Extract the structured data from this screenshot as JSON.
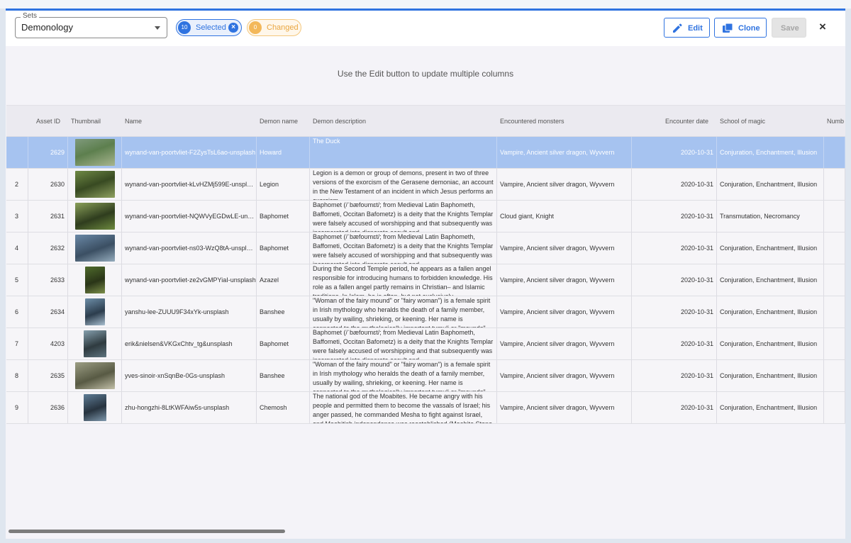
{
  "toolbar": {
    "sets_legend": "Sets",
    "sets_value": "Demonology",
    "selected_count": "10",
    "selected_label": "Selected",
    "changed_count": "0",
    "changed_label": "Changed",
    "edit_label": "Edit",
    "clone_label": "Clone",
    "save_label": "Save",
    "close_symbol": "×"
  },
  "hint": "Use the Edit button to update multiple columns",
  "columns": [
    "Asset ID",
    "Thumbnail",
    "Name",
    "Demon name",
    "Demon description",
    "Encountered monsters",
    "Encounter date",
    "School of magic",
    "Numb"
  ],
  "rows": [
    {
      "idx": "",
      "asset_id": "2629",
      "name": "wynand-van-poortvliet-F2ZysTsL6ao-unsplash",
      "demon": "Howard",
      "desc": "The Duck",
      "monsters": "Vampire, Ancient silver dragon, Wyvvern",
      "date": "2020-10-31",
      "school": "Conjuration, Enchantment, Illusion"
    },
    {
      "idx": "2",
      "asset_id": "2630",
      "name": "wynand-van-poortvliet-kLvHZMj599E-unsplas..",
      "demon": "Legion",
      "desc": "Legion is a demon or group of demons, present in two of three versions of the exorcism of the Gerasene demoniac, an account in the New Testament of an incident in which Jesus performs an exorcism.",
      "monsters": "Vampire, Ancient silver dragon, Wyvvern",
      "date": "2020-10-31",
      "school": "Conjuration, Enchantment, Illusion"
    },
    {
      "idx": "3",
      "asset_id": "2631",
      "name": "wynand-van-poortvliet-NQWVyEGDwLE-unspl..",
      "demon": "Baphomet",
      "desc": "Baphomet (/ˈbæfoʊmɛt/; from Medieval Latin Baphometh, Baffometi, Occitan Bafometz) is a deity that the Knights Templar were falsely accused of worshipping and that subsequently was incorporated into disparate occult and",
      "monsters": "Cloud giant, Knight",
      "date": "2020-10-31",
      "school": "Transmutation, Necromancy"
    },
    {
      "idx": "4",
      "asset_id": "2632",
      "name": "wynand-van-poortvliet-ns03-WzQ8tA-unsplas..",
      "demon": "Baphomet",
      "desc": "Baphomet (/ˈbæfoʊmɛt/; from Medieval Latin Baphometh, Baffometi, Occitan Bafometz) is a deity that the Knights Templar were falsely accused of worshipping and that subsequently was incorporated into disparate occult and",
      "monsters": "Vampire, Ancient silver dragon, Wyvvern",
      "date": "2020-10-31",
      "school": "Conjuration, Enchantment, Illusion"
    },
    {
      "idx": "5",
      "asset_id": "2633",
      "name": "wynand-van-poortvliet-ze2vGMPYiaI-unsplash",
      "demon": "Azazel",
      "desc": "During the Second Temple period, he appears as a fallen angel responsible for introducing humans to forbidden knowledge. His role as a fallen angel partly remains in Christian– and Islamic traditions. In Islam, he is often, but not exclusively",
      "monsters": "Vampire, Ancient silver dragon, Wyvvern",
      "date": "2020-10-31",
      "school": "Conjuration, Enchantment, Illusion"
    },
    {
      "idx": "6",
      "asset_id": "2634",
      "name": "yanshu-lee-ZUUU9F34xYk-unsplash",
      "demon": "Banshee",
      "desc": "\"Woman of the fairy mound\" or \"fairy woman\") is a female spirit in Irish mythology who heralds the death of a family member, usually by wailing, shrieking, or keening. Her name is connected to the mythologically important tumuli or \"mounds\"",
      "monsters": "Vampire, Ancient silver dragon, Wyvvern",
      "date": "2020-10-31",
      "school": "Conjuration, Enchantment, Illusion"
    },
    {
      "idx": "7",
      "asset_id": "4203",
      "name": "erik&nielsen&VKGxChtv_tg&unsplash",
      "demon": "Baphomet",
      "desc": "Baphomet (/ˈbæfoʊmɛt/; from Medieval Latin Baphometh, Baffometi, Occitan Bafometz) is a deity that the Knights Templar were falsely accused of worshipping and that subsequently was incorporated into disparate occult and",
      "monsters": "Vampire, Ancient silver dragon, Wyvvern",
      "date": "2020-10-31",
      "school": "Conjuration, Enchantment, Illusion"
    },
    {
      "idx": "8",
      "asset_id": "2635",
      "name": "yves-sinoir-xnSqnBe-0Gs-unsplash",
      "demon": "Banshee",
      "desc": "\"Woman of the fairy mound\" or \"fairy woman\") is a female spirit in Irish mythology who heralds the death of a family member, usually by wailing, shrieking, or keening. Her name is connected to the mythologically important tumuli or \"mounds\"",
      "monsters": "Vampire, Ancient silver dragon, Wyvvern",
      "date": "2020-10-31",
      "school": "Conjuration, Enchantment, Illusion"
    },
    {
      "idx": "9",
      "asset_id": "2636",
      "name": "zhu-hongzhi-8LtKWFAiw5s-unsplash",
      "demon": "Chemosh",
      "desc": "The national god of the Moabites. He became angry with his people and permitted them to become the vassals of Israel; his anger passed, he commanded Mesha to fight against Israel, and Moabitish independence was reestablished (Moabite Stone",
      "monsters": "Vampire, Ancient silver dragon, Wyvvern",
      "date": "2020-10-31",
      "school": "Conjuration, Enchantment, Illusion"
    }
  ],
  "colors": {
    "accent": "#2f73e0",
    "selected_row": "#a6c3f0",
    "changed": "#f3b85a"
  },
  "icons": {
    "caret": "chevron-down-icon",
    "edit": "pencil-icon",
    "clone": "copy-icon",
    "close": "close-icon",
    "cursor": "mouse-pointer-icon"
  }
}
